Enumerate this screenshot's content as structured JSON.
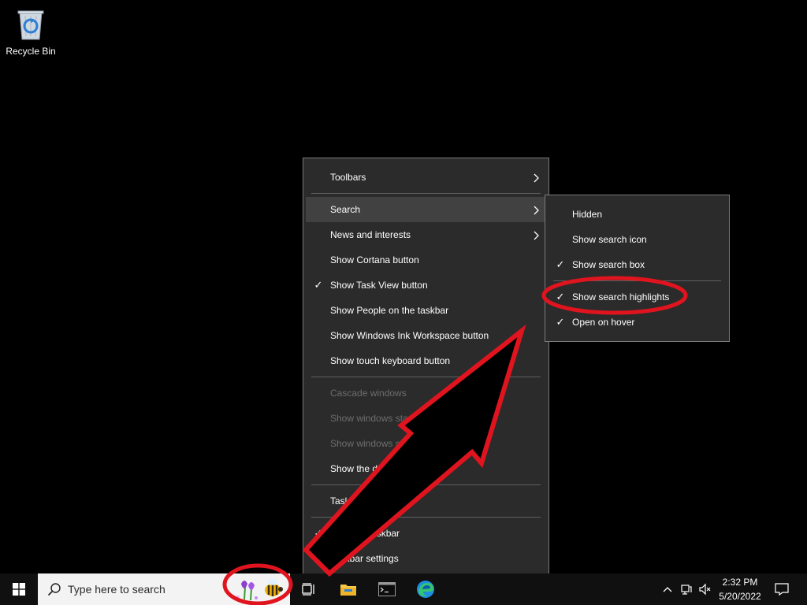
{
  "desktop": {
    "recycle_bin_label": "Recycle Bin"
  },
  "taskbar_menu": {
    "items": [
      {
        "label": "Toolbars",
        "submenu": true
      },
      {
        "label": "Search",
        "submenu": true,
        "highlighted": true
      },
      {
        "label": "News and interests",
        "submenu": true
      },
      {
        "label": "Show Cortana button"
      },
      {
        "label": "Show Task View button",
        "checked": true
      },
      {
        "label": "Show People on the taskbar"
      },
      {
        "label": "Show Windows Ink Workspace button"
      },
      {
        "label": "Show touch keyboard button"
      },
      {
        "label": "Cascade windows",
        "disabled": true
      },
      {
        "label": "Show windows stacked",
        "disabled": true
      },
      {
        "label": "Show windows side by side",
        "disabled": true
      },
      {
        "label": "Show the desktop"
      },
      {
        "label": "Task Manager"
      },
      {
        "label": "Lock the taskbar",
        "checked": true
      },
      {
        "label": "Taskbar settings",
        "icon": "gear-icon"
      }
    ]
  },
  "search_submenu": {
    "items": [
      {
        "label": "Hidden"
      },
      {
        "label": "Show search icon"
      },
      {
        "label": "Show search box",
        "checked": true
      },
      {
        "label": "Show search highlights",
        "checked": true
      },
      {
        "label": "Open on hover",
        "checked": true
      }
    ]
  },
  "taskbar": {
    "search_placeholder": "Type here to search",
    "icons": [
      "windows-start-icon",
      "search-icon",
      "search-highlight-flowers-bee-icon",
      "task-view-icon",
      "file-explorer-icon",
      "command-prompt-icon",
      "edge-icon"
    ],
    "clock_time": "2:32 PM",
    "clock_date": "5/20/2022"
  },
  "annotation": {
    "color": "#e0141e"
  }
}
